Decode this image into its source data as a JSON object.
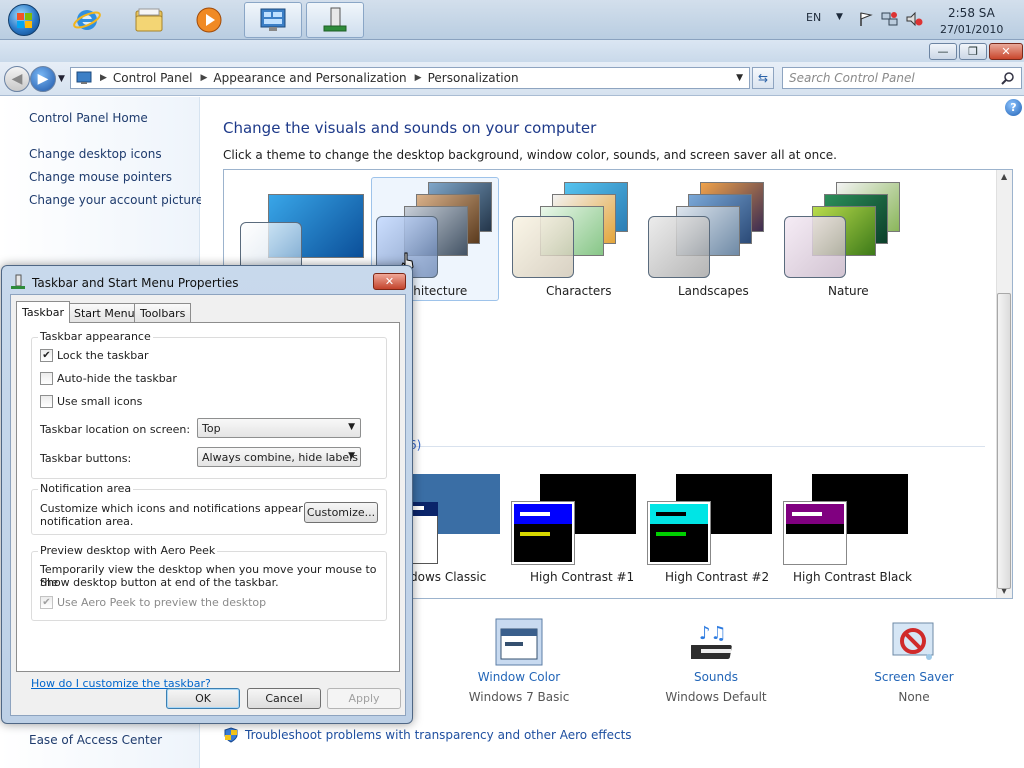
{
  "taskbar": {
    "language": "EN",
    "time": "2:58 SA",
    "date": "27/01/2010"
  },
  "window": {
    "minimize": "—",
    "restore": "❐",
    "close": "✕"
  },
  "address": {
    "segments": [
      "Control Panel",
      "Appearance and Personalization",
      "Personalization"
    ],
    "search_placeholder": "Search Control Panel"
  },
  "left_nav": {
    "home": "Control Panel Home",
    "links": [
      "Change desktop icons",
      "Change mouse pointers",
      "Change your account picture"
    ],
    "see_also": "Ease of Access Center"
  },
  "main": {
    "help": "?",
    "title": "Change the visuals and sounds on your computer",
    "subtitle": "Click a theme to change the desktop background, window color, sounds, and screen saver all at once.",
    "themes": [
      "rchitecture",
      "Characters",
      "Landscapes",
      "Nature"
    ],
    "basic_count": "6)",
    "basic_themes": [
      "dows Classic",
      "High Contrast #1",
      "High Contrast #2",
      "High Contrast Black"
    ],
    "settings": [
      {
        "title": "Window Color",
        "value": "Windows 7 Basic"
      },
      {
        "title": "Sounds",
        "value": "Windows Default"
      },
      {
        "title": "Screen Saver",
        "value": "None"
      }
    ],
    "troubleshoot": "Troubleshoot problems with transparency and other Aero effects"
  },
  "dialog": {
    "title": "Taskbar and Start Menu Properties",
    "close": "✕",
    "tabs": [
      "Taskbar",
      "Start Menu",
      "Toolbars"
    ],
    "appearance": {
      "title": "Taskbar appearance",
      "lock": "Lock the taskbar",
      "autohide": "Auto-hide the taskbar",
      "small_icons": "Use small icons",
      "location_label": "Taskbar location on screen:",
      "location_value": "Top",
      "buttons_label": "Taskbar buttons:",
      "buttons_value": "Always combine, hide labels"
    },
    "notification": {
      "title": "Notification area",
      "text_line1": "Customize which icons and notifications appear in the",
      "text_line2": "notification area.",
      "button": "Customize..."
    },
    "peek": {
      "title": "Preview desktop with Aero Peek",
      "text_line1": "Temporarily view the desktop when you move your mouse to the",
      "text_line2": "Show desktop button at end of the taskbar.",
      "option": "Use Aero Peek to preview the desktop"
    },
    "help_link": "How do I customize the taskbar?",
    "ok": "OK",
    "cancel": "Cancel",
    "apply": "Apply"
  }
}
